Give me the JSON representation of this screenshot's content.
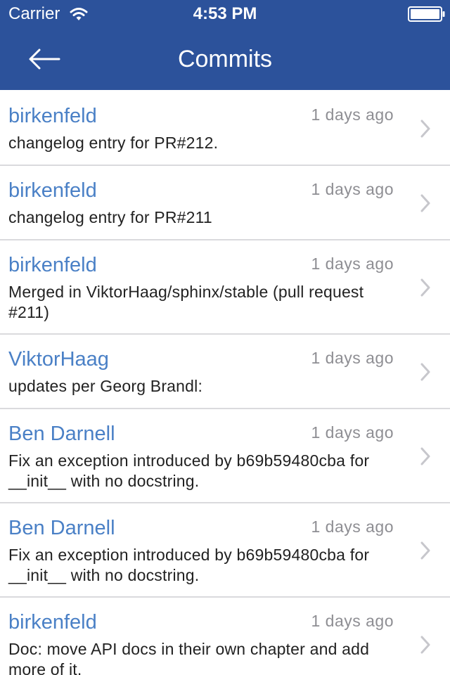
{
  "status_bar": {
    "carrier": "Carrier",
    "time": "4:53 PM",
    "wifi_icon": "wifi-icon",
    "battery_icon": "battery-icon"
  },
  "nav": {
    "title": "Commits",
    "back_icon": "back-arrow-icon"
  },
  "colors": {
    "nav_background": "#2c529b",
    "author_text": "#4a80c6",
    "age_text": "#8e8e93",
    "separator": "#dadadd",
    "chevron": "#c7c7cc"
  },
  "commits": [
    {
      "author": "birkenfeld",
      "age": "1 days ago",
      "message": "changelog entry for PR#212."
    },
    {
      "author": "birkenfeld",
      "age": "1 days ago",
      "message": "changelog entry for PR#211"
    },
    {
      "author": "birkenfeld",
      "age": "1 days ago",
      "message": "Merged in ViktorHaag/sphinx/stable (pull request #211)"
    },
    {
      "author": "ViktorHaag",
      "age": "1 days ago",
      "message": "updates per Georg Brandl:"
    },
    {
      "author": "Ben Darnell",
      "age": "1 days ago",
      "message": "Fix an exception introduced by b69b59480cba for __init__ with no docstring."
    },
    {
      "author": "Ben Darnell",
      "age": "1 days ago",
      "message": "Fix an exception introduced by b69b59480cba for __init__ with no docstring."
    },
    {
      "author": "birkenfeld",
      "age": "1 days ago",
      "message": "Doc: move API docs in their own chapter and add more of it."
    }
  ]
}
